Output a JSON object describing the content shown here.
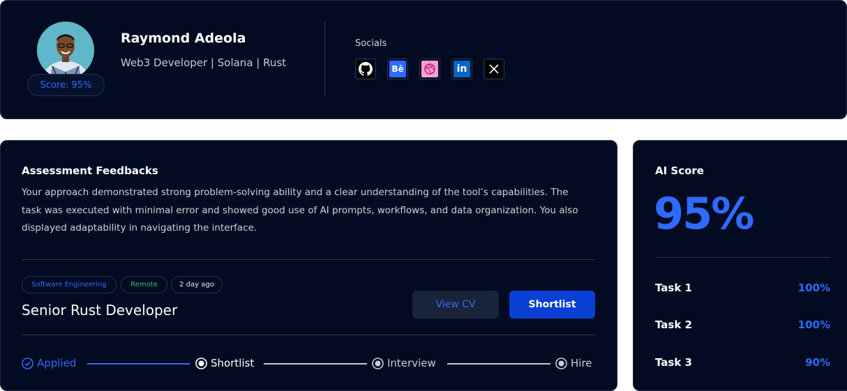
{
  "profile": {
    "name": "Raymond Adeola",
    "role": "Web3 Developer | Solana | Rust",
    "score_pill": "Score: 95%",
    "socials_label": "Socials",
    "socials": [
      {
        "icon": "github-icon",
        "color": "#000000"
      },
      {
        "icon": "behance-icon",
        "color": "#2f6bff"
      },
      {
        "icon": "dribbble-icon",
        "color": "#f4a0d8"
      },
      {
        "icon": "linkedin-icon",
        "color": "#0a66c2"
      },
      {
        "icon": "x-icon",
        "color": "#000000"
      }
    ]
  },
  "assessment": {
    "title": "Assessment Feedbacks",
    "feedback": "Your approach demonstrated strong problem-solving ability and a clear understanding of the tool’s capabilities. The task was executed with minimal error and showed good use of AI prompts, workflows, and data organization. You also displayed adaptability in navigating the interface.",
    "tags": [
      "Software Engineering",
      "Remote",
      "2 day ago"
    ],
    "job_title": "Senior Rust Developer",
    "view_cv": "View CV",
    "shortlist": "Shortlist",
    "steps": [
      "Applied",
      "Shortlist",
      "Interview",
      "Hire"
    ]
  },
  "ai": {
    "title": "AI Score",
    "score": "95%",
    "tasks": [
      {
        "label": "Task 1",
        "value": "100%"
      },
      {
        "label": "Task 2",
        "value": "100%"
      },
      {
        "label": "Task 3",
        "value": "90%"
      }
    ]
  },
  "colors": {
    "accent": "#2f6bff",
    "background": "#020b21",
    "button": "#0a3fd6",
    "remote_tag": "#2ec27e"
  }
}
